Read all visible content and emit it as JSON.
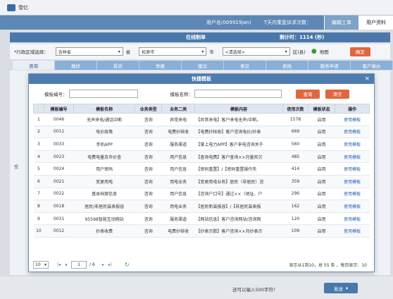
{
  "window": {
    "title": "雪亿"
  },
  "topbar": {
    "user_info": "用户名(009919jan)",
    "today_info": "T天内重复诉求次数：",
    "tab1": "编辑工单",
    "tab2": "用户资料"
  },
  "strip": {
    "title": "在线制单",
    "timer": "剩计时：1114 (秒)"
  },
  "filter": {
    "region_label": "*行政区域选择：",
    "province": "吉林省",
    "province_suffix": "省",
    "city": "松原市",
    "city_suffix": "市",
    "county": "<请选择>",
    "county_suffix": "区(县)",
    "map_label": "地图",
    "confirm_label": "确定"
  },
  "bg_tabs": [
    "咨询",
    "报修",
    "投诉",
    "举报",
    "建议",
    "意见",
    "表扬",
    "服务申请",
    "客户催办"
  ],
  "side_mark": "受",
  "modal": {
    "title": "快捷模板",
    "close_icon": "×",
    "code_label": "模板编号：",
    "name_label": "模板名称：",
    "search_label": "查询",
    "clear_label": "清空",
    "columns": [
      "",
      "模板编号",
      "模板名称",
      "业务类型",
      "业务二类",
      "模板内容",
      "使用次数",
      "模板状态",
      "操作"
    ],
    "rows": [
      [
        "1",
        "0046",
        "无声来电/通话中断",
        "咨询",
        "异常来电",
        "【异常来电】客户来电无声/中断。",
        "1578",
        "启用",
        "使用模板"
      ],
      [
        "2",
        "0011",
        "电价政策",
        "咨询",
        "电费抄核收",
        "【电费抄核收】客户咨询电价/抄表",
        "669",
        "启用",
        "使用模板"
      ],
      [
        "3",
        "0033",
        "手机APP",
        "咨询",
        "服务渠道",
        "【掌上电力APP】客户来电咨询关于",
        "560",
        "启用",
        "使用模板"
      ],
      [
        "4",
        "0023",
        "电费电量及市价查",
        "咨询",
        "用户信息",
        "【查询电费】客户查询××月量否欠",
        "485",
        "启用",
        "使用模板"
      ],
      [
        "5",
        "0024",
        "用户密码",
        "咨询",
        "用户信息",
        "【密码重置】/【密码重置操作失",
        "414",
        "启用",
        "使用模板"
      ],
      [
        "6",
        "0021",
        "变更用电",
        "咨询",
        "用电业务",
        "【变更用电业务】居民（非居民）咨",
        "359",
        "启用",
        "使用模板"
      ],
      [
        "7",
        "0022",
        "基本档案信息",
        "咨询",
        "用户信息",
        "【咨询户口号】通过××（地址、户",
        "296",
        "启用",
        "使用模板"
      ],
      [
        "8",
        "0018",
        "居民/非居民装表报容",
        "咨询",
        "用电业务",
        "【居民新装报容】/【非居民装表报",
        "162",
        "启用",
        "使用模板"
      ],
      [
        "9",
        "0031",
        "95598智能互动网站",
        "咨询",
        "服务渠道",
        "【网站信息】客户咨询网站/咨询网",
        "120",
        "启用",
        "使用模板"
      ],
      [
        "10",
        "0012",
        "抄表收费",
        "咨询",
        "电费抄核收",
        "【抄表示数】客户咨询××月抄表示",
        "109",
        "启用",
        "使用模板"
      ]
    ],
    "pager": {
      "page_size": "10",
      "current_page": "1",
      "of_pages": "/ 6",
      "summary": "显示从1到10，总 55 条 ，每页显示：10"
    }
  },
  "bottom": {
    "hint": "还可以输入500字符！",
    "send_label": "发送"
  },
  "colors": {
    "primary": "#4a78ab",
    "accent": "#e0663f",
    "link": "#2a62b8"
  }
}
